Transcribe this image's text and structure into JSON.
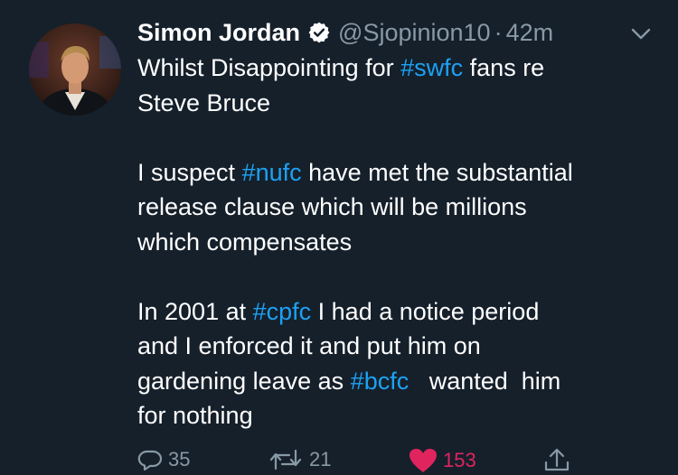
{
  "tweet": {
    "author_name": "Simon Jordan",
    "handle": "@Sjopinion10",
    "separator": "·",
    "time": "42m",
    "lines": [
      {
        "pre": "Whilst Disappointing for ",
        "tag": "#swfc",
        "post": " fans re"
      },
      {
        "pre": "Steve Bruce",
        "tag": "",
        "post": ""
      },
      {
        "pre": "",
        "tag": "",
        "post": ""
      },
      {
        "pre": "I suspect ",
        "tag": "#nufc",
        "post": " have met the substantial"
      },
      {
        "pre": "release clause which will be millions",
        "tag": "",
        "post": ""
      },
      {
        "pre": "which compensates",
        "tag": "",
        "post": ""
      },
      {
        "pre": "",
        "tag": "",
        "post": ""
      },
      {
        "pre": "In 2001 at ",
        "tag": "#cpfc",
        "post": " I had a notice period"
      },
      {
        "pre": "and I enforced it and put him on",
        "tag": "",
        "post": ""
      },
      {
        "pre": "gardening leave as ",
        "tag": "#bcfc",
        "post": "   wanted  him"
      },
      {
        "pre": "for nothing",
        "tag": "",
        "post": ""
      }
    ],
    "actions": {
      "replies": "35",
      "retweets": "21",
      "likes": "153"
    },
    "icons": {
      "verified": "verified-badge-icon",
      "caret": "chevron-down-icon",
      "reply": "reply-icon",
      "retweet": "retweet-icon",
      "like": "heart-icon",
      "share": "share-icon"
    },
    "colors": {
      "background": "#15202b",
      "hashtag": "#1da1f2",
      "muted": "#8899a6",
      "like": "#e0245e"
    }
  }
}
